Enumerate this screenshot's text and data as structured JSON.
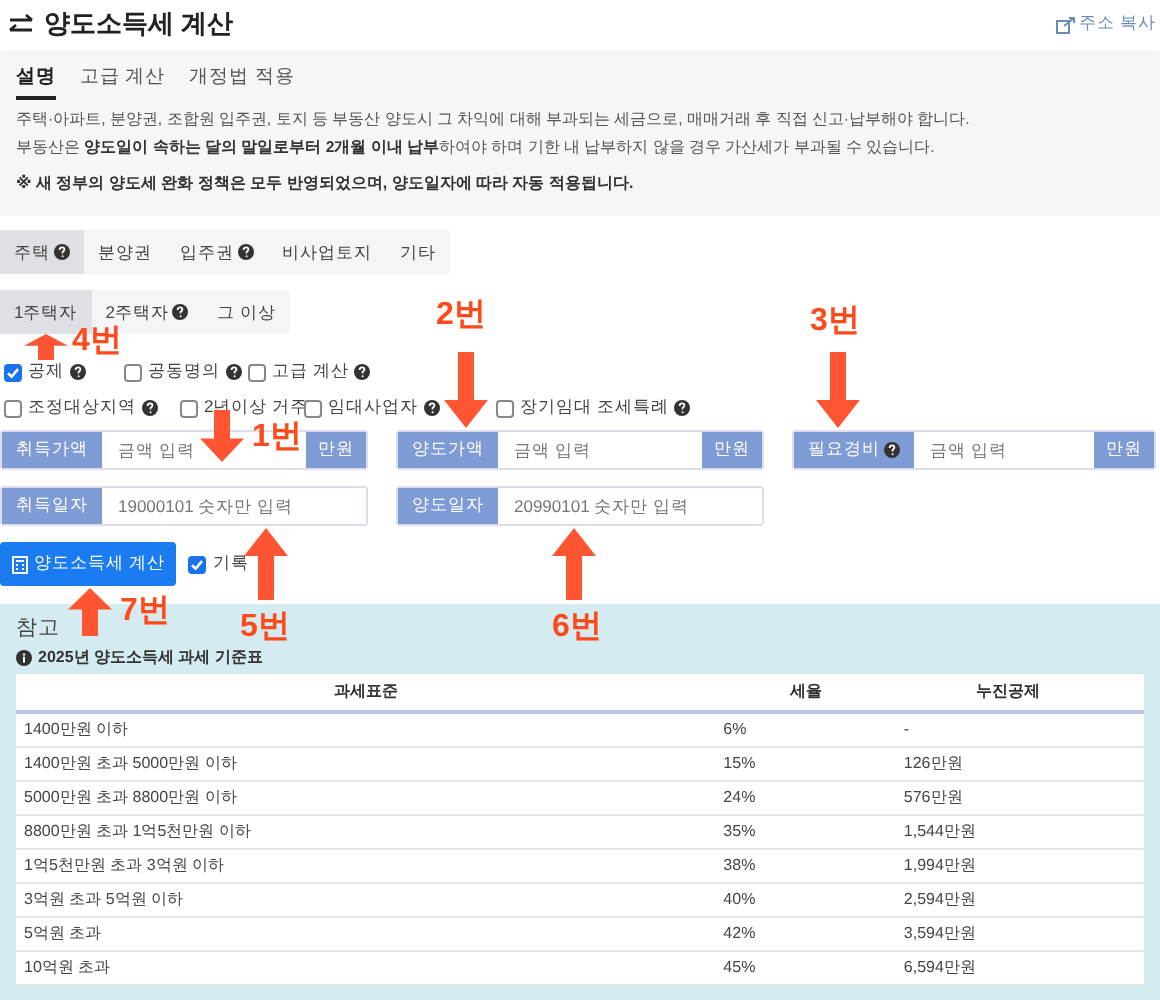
{
  "header": {
    "title": "양도소득세 계산",
    "copy_link": "주소 복사"
  },
  "info": {
    "tabs": [
      {
        "label": "설명",
        "selected": true
      },
      {
        "label": "고급 계산",
        "selected": false
      },
      {
        "label": "개정법 적용",
        "selected": false
      }
    ],
    "paragraphs": [
      "주택·아파트, 분양권, 조합원 입주권, 토지 등 부동산 양도시 그 차익에 대해 부과되는 세금으로, 매매거래 후 직접 신고·납부해야 합니다.",
      "부동산은 **양도일이 속하는 달의 말일로부터 2개월 이내 납부**하여야 하며 기한 내 납부하지 않을 경우 가산세가 부과될 수 있습니다."
    ],
    "notice": "※ 새 정부의 양도세 완화 정책은 모두 반영되었으며, 양도일자에 따라 자동 적용됩니다."
  },
  "property_types": [
    {
      "label": "주택",
      "help": true,
      "selected": true
    },
    {
      "label": "분양권",
      "help": false,
      "selected": false
    },
    {
      "label": "입주권",
      "help": true,
      "selected": false
    },
    {
      "label": "비사업토지",
      "help": false,
      "selected": false
    },
    {
      "label": "기타",
      "help": false,
      "selected": false
    }
  ],
  "owner_counts": [
    {
      "label": "1주택자",
      "help": false,
      "selected": true
    },
    {
      "label": "2주택자",
      "help": true,
      "selected": false
    },
    {
      "label": "그 이상",
      "help": false,
      "selected": false
    }
  ],
  "option_rows": [
    {
      "options": [
        {
          "label": "공제",
          "help": true,
          "checked": true
        },
        {
          "label": "공동명의",
          "help": true,
          "checked": false
        },
        {
          "label": "고급 계산",
          "help": true,
          "checked": false
        }
      ]
    },
    {
      "options": [
        {
          "label": "조정대상지역",
          "help": true,
          "checked": false
        },
        {
          "label": "2년이상 거주",
          "help": false,
          "checked": false
        },
        {
          "label": "임대사업자",
          "help": true,
          "checked": false
        },
        {
          "label": "장기임대 조세특례",
          "help": true,
          "checked": false
        }
      ]
    }
  ],
  "fields": [
    {
      "label": "취득가액",
      "help": false,
      "placeholder": "금액 입력",
      "unit": "만원"
    },
    {
      "label": "양도가액",
      "help": false,
      "placeholder": "금액 입력",
      "unit": "만원"
    },
    {
      "label": "필요경비",
      "help": true,
      "placeholder": "금액 입력",
      "unit": "만원"
    },
    {
      "label": "취득일자",
      "help": false,
      "placeholder": "19000101 숫자만 입력"
    },
    {
      "label": "양도일자",
      "help": false,
      "placeholder": "20990101 숫자만 입력"
    }
  ],
  "submit": {
    "label": "양도소득세 계산",
    "record": {
      "label": "기록",
      "checked": true
    }
  },
  "reference": {
    "title": "참고",
    "table_title": "2025년 양도소득세 과세 기준표",
    "columns": [
      "과세표준",
      "세율",
      "누진공제"
    ],
    "rows": [
      [
        "1400만원 이하",
        "6%",
        "-"
      ],
      [
        "1400만원 초과 5000만원 이하",
        "15%",
        "126만원"
      ],
      [
        "5000만원 초과 8800만원 이하",
        "24%",
        "576만원"
      ],
      [
        "8800만원 초과 1억5천만원 이하",
        "35%",
        "1,544만원"
      ],
      [
        "1억5천만원 초과 3억원 이하",
        "38%",
        "1,994만원"
      ],
      [
        "3억원 초과 5억원 이하",
        "40%",
        "2,594만원"
      ],
      [
        "5억원 초과",
        "42%",
        "3,594만원"
      ],
      [
        "10억원 초과",
        "45%",
        "6,594만원"
      ]
    ]
  },
  "annotations": [
    "1번",
    "2번",
    "3번",
    "4번",
    "5번",
    "6번",
    "7번"
  ]
}
